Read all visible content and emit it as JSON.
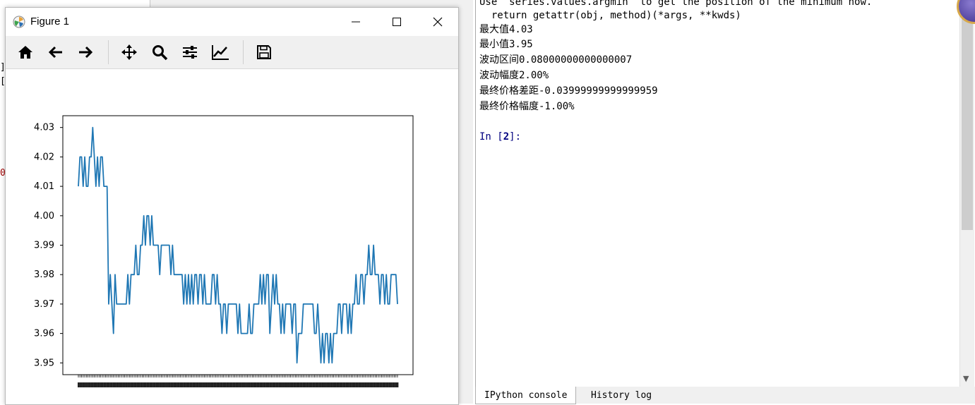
{
  "figure_window": {
    "title": "Figure 1",
    "controls": {
      "minimize": "—",
      "maximize": "☐",
      "close": "✕"
    },
    "toolbar_tools": [
      "home-icon",
      "back-arrow-icon",
      "forward-arrow-icon",
      "pan-icon",
      "zoom-icon",
      "configure-subplots-icon",
      "edit-axes-icon",
      "save-icon"
    ]
  },
  "ide_gutter": [
    "]",
    "[",
    "0"
  ],
  "console": {
    "lines": [
      "Use `series.values.argmin` to get the position of the minimum now.",
      "  return getattr(obj, method)(*args, **kwds)",
      "最大值4.03",
      "最小值3.95",
      "波动区间0.08000000000000007",
      "波动幅度2.00%",
      "最终价格差距-0.03999999999999959",
      "最终价格幅度-1.00%"
    ],
    "prompt_prefix": "In [",
    "prompt_number": "2",
    "prompt_suffix": "]:",
    "tabs": [
      "IPython console",
      "History log"
    ]
  },
  "chart_data": {
    "type": "line",
    "series": [
      {
        "color": "#1f77b4",
        "values": [
          4.01,
          4.02,
          4.02,
          4.01,
          4.02,
          4.01,
          4.01,
          4.02,
          4.02,
          4.03,
          4.02,
          4.01,
          4.02,
          4.01,
          4.02,
          4.02,
          4.01,
          4.01,
          4.01,
          3.97,
          3.98,
          3.97,
          3.96,
          3.98,
          3.97,
          3.97,
          3.97,
          3.97,
          3.97,
          3.97,
          3.97,
          3.98,
          3.97,
          3.98,
          3.98,
          3.98,
          3.99,
          3.98,
          3.98,
          3.99,
          3.99,
          4.0,
          3.99,
          4.0,
          4.0,
          3.99,
          4.0,
          3.99,
          3.99,
          3.99,
          3.99,
          3.98,
          3.99,
          3.99,
          3.99,
          3.99,
          3.99,
          3.99,
          3.98,
          3.99,
          3.98,
          3.98,
          3.98,
          3.98,
          3.98,
          3.98,
          3.97,
          3.98,
          3.97,
          3.98,
          3.97,
          3.98,
          3.97,
          3.98,
          3.98,
          3.97,
          3.98,
          3.98,
          3.97,
          3.98,
          3.97,
          3.97,
          3.97,
          3.97,
          3.98,
          3.98,
          3.97,
          3.98,
          3.97,
          3.97,
          3.96,
          3.97,
          3.97,
          3.96,
          3.97,
          3.97,
          3.97,
          3.97,
          3.97,
          3.97,
          3.96,
          3.97,
          3.96,
          3.96,
          3.96,
          3.96,
          3.96,
          3.97,
          3.96,
          3.96,
          3.97,
          3.97,
          3.97,
          3.97,
          3.98,
          3.97,
          3.98,
          3.97,
          3.98,
          3.98,
          3.96,
          3.97,
          3.98,
          3.97,
          3.98,
          3.97,
          3.97,
          3.96,
          3.97,
          3.96,
          3.97,
          3.97,
          3.97,
          3.97,
          3.96,
          3.97,
          3.97,
          3.95,
          3.96,
          3.96,
          3.96,
          3.97,
          3.97,
          3.97,
          3.97,
          3.97,
          3.97,
          3.97,
          3.96,
          3.96,
          3.97,
          3.96,
          3.95,
          3.96,
          3.95,
          3.96,
          3.96,
          3.95,
          3.96,
          3.95,
          3.96,
          3.96,
          3.96,
          3.97,
          3.97,
          3.96,
          3.97,
          3.97,
          3.97,
          3.96,
          3.97,
          3.96,
          3.97,
          3.97,
          3.98,
          3.97,
          3.97,
          3.98,
          3.98,
          3.97,
          3.98,
          3.98,
          3.99,
          3.98,
          3.98,
          3.99,
          3.98,
          3.98,
          3.98,
          3.97,
          3.98,
          3.98,
          3.97,
          3.98,
          3.97,
          3.97,
          3.98,
          3.98,
          3.98,
          3.98,
          3.97
        ]
      }
    ],
    "ylim": [
      3.946,
      4.034
    ],
    "y_ticks": [
      "3.95",
      "3.96",
      "3.97",
      "3.98",
      "3.99",
      "4.00",
      "4.01",
      "4.02",
      "4.03"
    ],
    "x_ticks_dense": true,
    "grid": false
  }
}
